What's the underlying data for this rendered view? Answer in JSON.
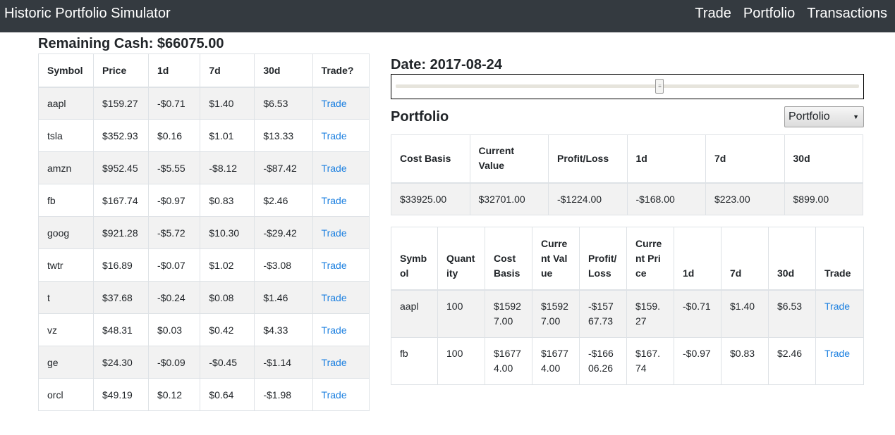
{
  "nav": {
    "brand": "Historic Portfolio Simulator",
    "links": [
      "Trade",
      "Portfolio",
      "Transactions"
    ]
  },
  "cash_label": "Remaining Cash: $66075.00",
  "date_label": "Date: 2017-08-24",
  "slider": {
    "position_fraction": 0.57
  },
  "portfolio": {
    "title": "Portfolio",
    "select_value": "Portfolio"
  },
  "stocks": {
    "headers": [
      "Symbol",
      "Price",
      "1d",
      "7d",
      "30d",
      "Trade?"
    ],
    "rows": [
      [
        "aapl",
        "$159.27",
        "-$0.71",
        "$1.40",
        "$6.53",
        "Trade"
      ],
      [
        "tsla",
        "$352.93",
        "$0.16",
        "$1.01",
        "$13.33",
        "Trade"
      ],
      [
        "amzn",
        "$952.45",
        "-$5.55",
        "-$8.12",
        "-$87.42",
        "Trade"
      ],
      [
        "fb",
        "$167.74",
        "-$0.97",
        "$0.83",
        "$2.46",
        "Trade"
      ],
      [
        "goog",
        "$921.28",
        "-$5.72",
        "$10.30",
        "-$29.42",
        "Trade"
      ],
      [
        "twtr",
        "$16.89",
        "-$0.07",
        "$1.02",
        "-$3.08",
        "Trade"
      ],
      [
        "t",
        "$37.68",
        "-$0.24",
        "$0.08",
        "$1.46",
        "Trade"
      ],
      [
        "vz",
        "$48.31",
        "$0.03",
        "$0.42",
        "$4.33",
        "Trade"
      ],
      [
        "ge",
        "$24.30",
        "-$0.09",
        "-$0.45",
        "-$1.14",
        "Trade"
      ],
      [
        "orcl",
        "$49.19",
        "$0.12",
        "$0.64",
        "-$1.98",
        "Trade"
      ]
    ]
  },
  "summary": {
    "headers": [
      "Cost Basis",
      "Current Value",
      "Profit/Loss",
      "1d",
      "7d",
      "30d"
    ],
    "values": [
      "$33925.00",
      "$32701.00",
      "-$1224.00",
      "-$168.00",
      "$223.00",
      "$899.00"
    ]
  },
  "holdings": {
    "headers": [
      "Symbol",
      "Quantity",
      "Cost Basis",
      "Current Value",
      "Profit/Loss",
      "Current Price",
      "1d",
      "7d",
      "30d",
      "Trade"
    ],
    "rows": [
      [
        "aapl",
        "100",
        "$15927.00",
        "$15927.00",
        "-$15767.73",
        "$159.27",
        "-$0.71",
        "$1.40",
        "$6.53",
        "Trade"
      ],
      [
        "fb",
        "100",
        "$16774.00",
        "$16774.00",
        "-$16606.26",
        "$167.74",
        "-$0.97",
        "$0.83",
        "$2.46",
        "Trade"
      ]
    ]
  }
}
